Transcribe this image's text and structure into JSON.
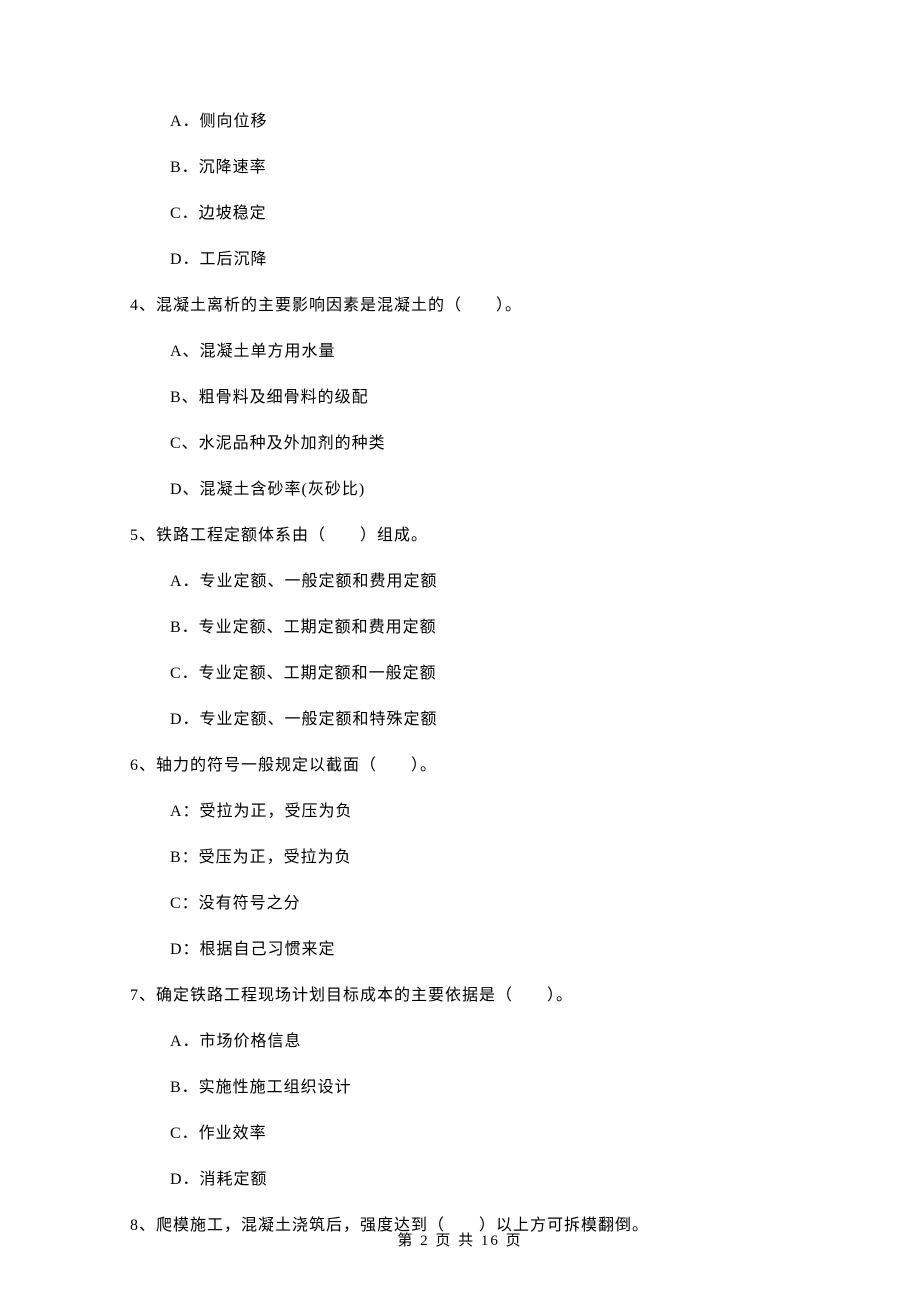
{
  "q3_options": {
    "A": "A．侧向位移",
    "B": "B．沉降速率",
    "C": "C．边坡稳定",
    "D": "D．工后沉降"
  },
  "q4": {
    "text": "4、混凝土离析的主要影响因素是混凝土的（　　）。",
    "A": "A、混凝土单方用水量",
    "B": "B、粗骨料及细骨料的级配",
    "C": "C、水泥品种及外加剂的种类",
    "D": "D、混凝土含砂率(灰砂比)"
  },
  "q5": {
    "text": "5、铁路工程定额体系由（　　）组成。",
    "A": "A．专业定额、一般定额和费用定额",
    "B": "B．专业定额、工期定额和费用定额",
    "C": "C．专业定额、工期定额和一般定额",
    "D": "D．专业定额、一般定额和特殊定额"
  },
  "q6": {
    "text": "6、轴力的符号一般规定以截面（　　）。",
    "A": "A：受拉为正，受压为负",
    "B": "B：受压为正，受拉为负",
    "C": "C：没有符号之分",
    "D": "D：根据自己习惯来定"
  },
  "q7": {
    "text": "7、确定铁路工程现场计划目标成本的主要依据是（　　）。",
    "A": "A．市场价格信息",
    "B": "B．实施性施工组织设计",
    "C": "C．作业效率",
    "D": "D．消耗定额"
  },
  "q8": {
    "text": "8、爬模施工，混凝土浇筑后，强度达到（　　）以上方可拆模翻倒。"
  },
  "footer": "第 2 页 共 16 页"
}
